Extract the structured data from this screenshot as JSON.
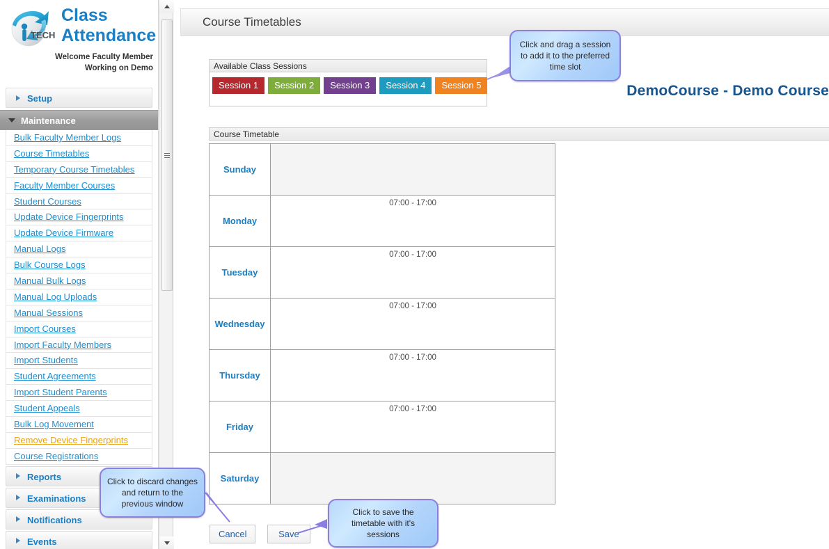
{
  "brand": {
    "line1": "Class",
    "line2": "Attendance",
    "logo_text": "TECH",
    "welcome_line1": "Welcome Faculty Member",
    "welcome_line2": "Working on Demo"
  },
  "sidebar": {
    "sections": [
      {
        "label": "Setup",
        "expanded": false,
        "icon": "chevron-right-icon"
      },
      {
        "label": "Maintenance",
        "expanded": true,
        "icon": "chevron-down-icon"
      }
    ],
    "maintenance_links": [
      {
        "label": "Bulk Faculty Member Logs",
        "highlight": false
      },
      {
        "label": "Course Timetables",
        "highlight": false
      },
      {
        "label": "Temporary Course Timetables",
        "highlight": false
      },
      {
        "label": "Faculty Member Courses",
        "highlight": false
      },
      {
        "label": "Student Courses",
        "highlight": false
      },
      {
        "label": "Update Device Fingerprints",
        "highlight": false
      },
      {
        "label": "Update Device Firmware",
        "highlight": false
      },
      {
        "label": "Manual Logs",
        "highlight": false
      },
      {
        "label": "Bulk Course Logs",
        "highlight": false
      },
      {
        "label": "Manual Bulk Logs",
        "highlight": false
      },
      {
        "label": "Manual Log Uploads",
        "highlight": false
      },
      {
        "label": "Manual Sessions",
        "highlight": false
      },
      {
        "label": "Import Courses",
        "highlight": false
      },
      {
        "label": "Import Faculty Members",
        "highlight": false
      },
      {
        "label": "Import Students",
        "highlight": false
      },
      {
        "label": "Student Agreements",
        "highlight": false
      },
      {
        "label": "Import Student Parents",
        "highlight": false
      },
      {
        "label": "Student Appeals",
        "highlight": false
      },
      {
        "label": "Bulk Log Movement",
        "highlight": false
      },
      {
        "label": "Remove Device Fingerprints",
        "highlight": true
      },
      {
        "label": "Course Registrations",
        "highlight": false
      }
    ],
    "footer_sections": [
      {
        "label": "Reports"
      },
      {
        "label": "Examinations"
      },
      {
        "label": "Notifications"
      },
      {
        "label": "Events"
      }
    ]
  },
  "header": {
    "title": "Course Timetables"
  },
  "main": {
    "course_title": "DemoCourse - Demo Course",
    "sessions_caption": "Available Class Sessions",
    "timetable_caption": "Course Timetable",
    "sessions": [
      {
        "label": "Session 1",
        "color": "#b5282e"
      },
      {
        "label": "Session 2",
        "color": "#7fad3c"
      },
      {
        "label": "Session 3",
        "color": "#73408f"
      },
      {
        "label": "Session 4",
        "color": "#1d9cbf"
      },
      {
        "label": "Session 5",
        "color": "#ef8322"
      }
    ],
    "timetable_rows": [
      {
        "day": "Sunday",
        "time": "",
        "weekend": true
      },
      {
        "day": "Monday",
        "time": "07:00 - 17:00",
        "weekend": false
      },
      {
        "day": "Tuesday",
        "time": "07:00 - 17:00",
        "weekend": false
      },
      {
        "day": "Wednesday",
        "time": "07:00 - 17:00",
        "weekend": false
      },
      {
        "day": "Thursday",
        "time": "07:00 - 17:00",
        "weekend": false
      },
      {
        "day": "Friday",
        "time": "07:00 - 17:00",
        "weekend": false
      },
      {
        "day": "Saturday",
        "time": "",
        "weekend": true
      }
    ],
    "cancel_label": "Cancel",
    "save_label": "Save"
  },
  "callouts": {
    "drag": "Click and drag a session to add it to the preferred time slot",
    "cancel": "Click to discard changes and return to the previous window",
    "save": "Click to save the timetable with it's sessions"
  },
  "colors": {
    "brand_blue": "#1b7fc4",
    "link_blue": "#1b8fd4",
    "highlight_orange": "#e8a317",
    "course_title": "#17558f",
    "callout_border": "#8a7fe0"
  }
}
